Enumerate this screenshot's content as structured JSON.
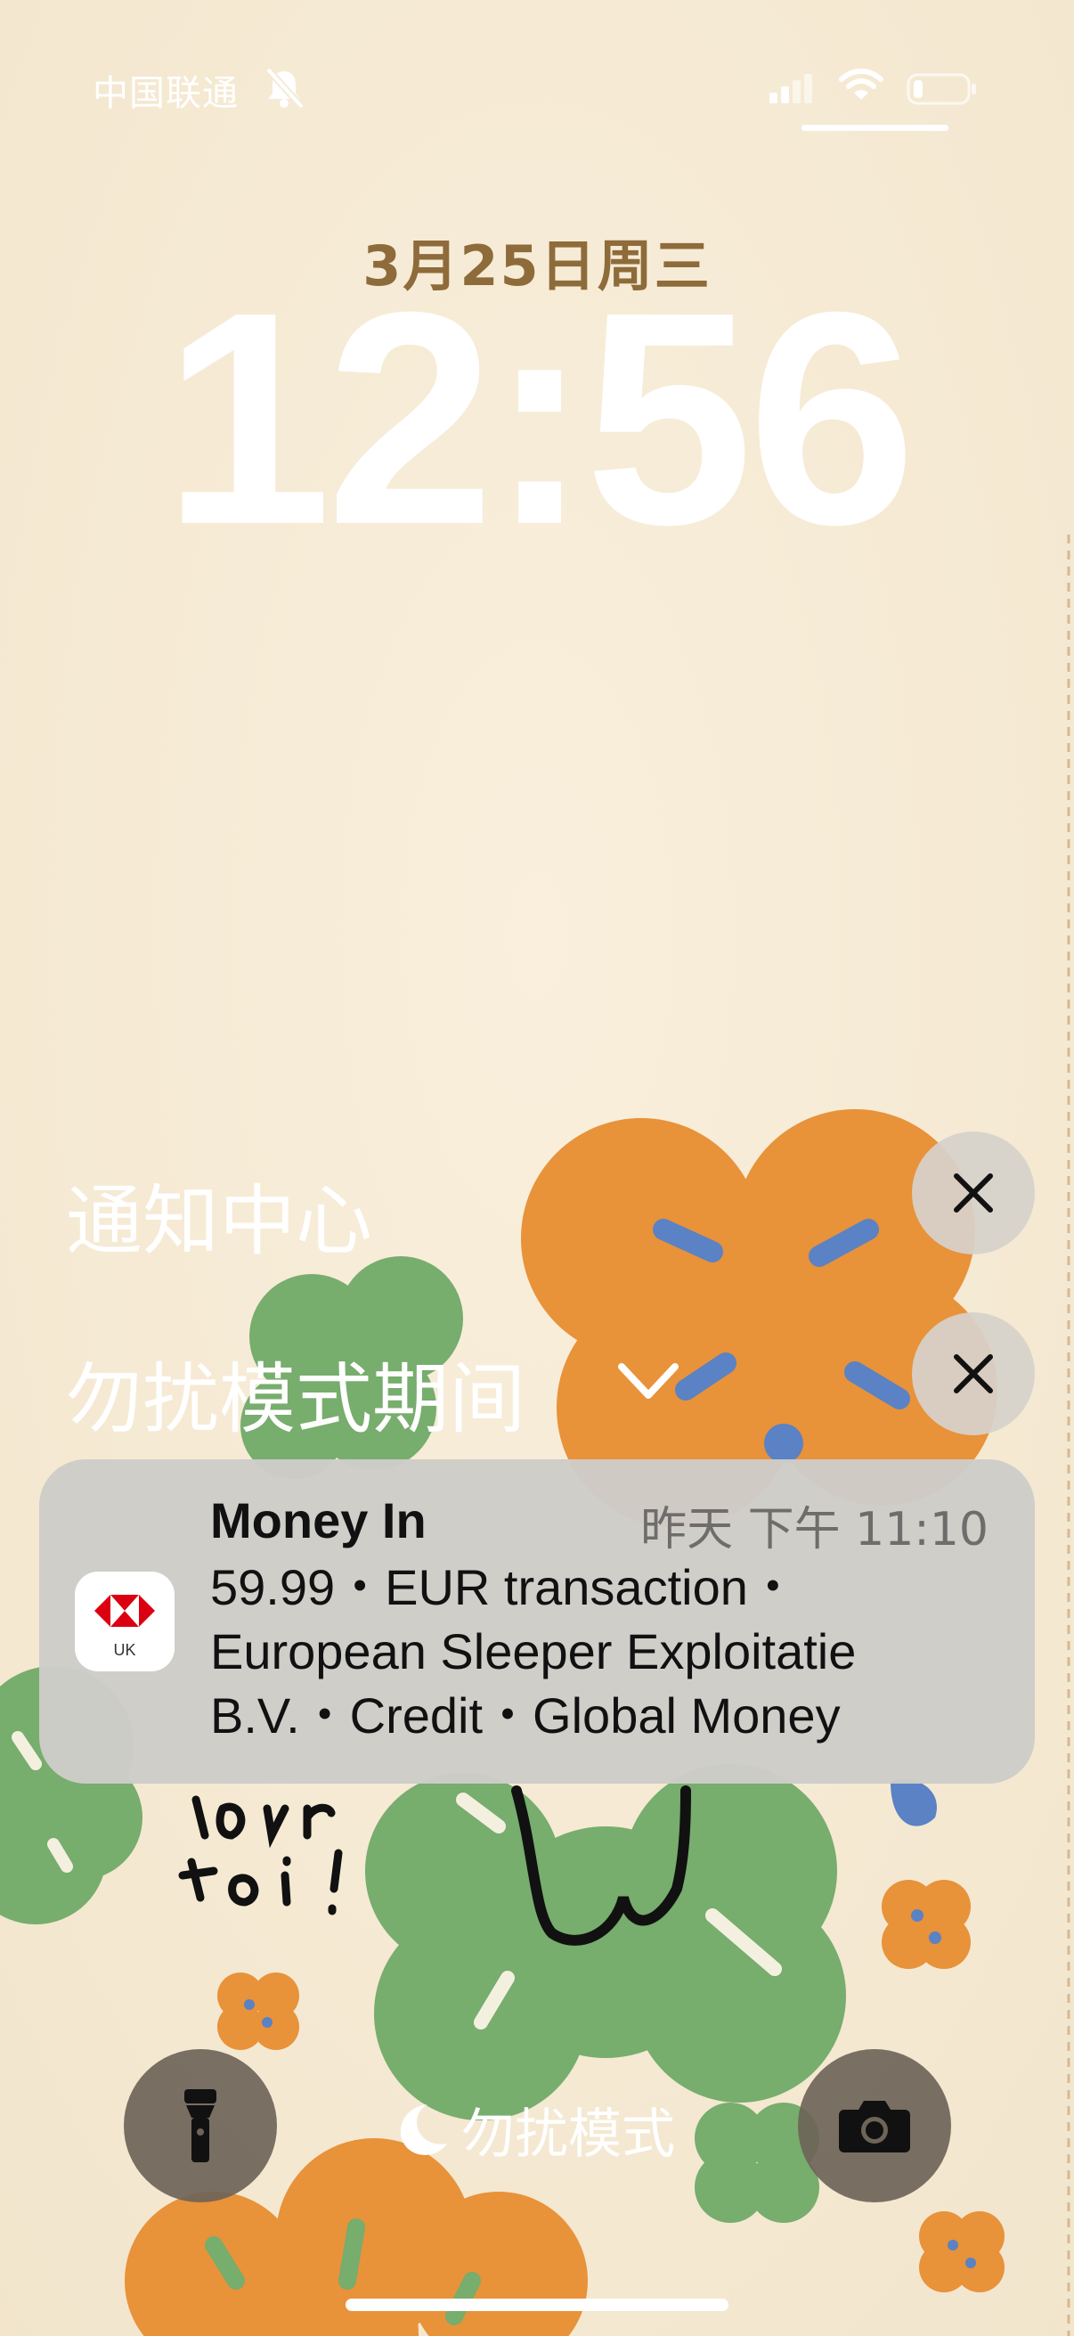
{
  "status_bar": {
    "carrier": "中国联通",
    "icons": [
      "bell-slash-icon",
      "cellular-signal-icon",
      "wifi-icon",
      "battery-low-icon"
    ]
  },
  "lock_screen": {
    "date": "3月25日周三",
    "time": "12:56"
  },
  "notification_center": {
    "title": "通知中心",
    "dnd_section": "勿扰模式期间"
  },
  "notification": {
    "app_icon": "hsbc-uk-icon",
    "app_icon_text": "UK",
    "title": "Money In",
    "time": "昨天 下午 11:10",
    "body_lines": [
      " 59.99・EUR transaction・",
      "European Sleeper Exploitatie",
      "B.V.・Credit・Global Money"
    ]
  },
  "bottom": {
    "focus_label": "勿扰模式",
    "left_button": "flashlight-icon",
    "right_button": "camera-icon"
  },
  "colors": {
    "background": "#f7ecd6",
    "date_text": "#8e6b3a",
    "flower_orange": "#e8923a",
    "flower_green": "#77ad6d",
    "flower_blue": "#5a82c4"
  }
}
